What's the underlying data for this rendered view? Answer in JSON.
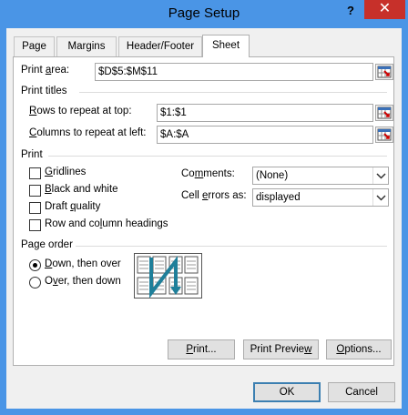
{
  "window": {
    "title": "Page Setup",
    "help_label": "?",
    "close_label": "✕"
  },
  "tabs": [
    {
      "label": "Page"
    },
    {
      "label": "Margins"
    },
    {
      "label": "Header/Footer"
    },
    {
      "label": "Sheet"
    }
  ],
  "print_area": {
    "label_pre": "Print ",
    "label_key": "a",
    "label_post": "rea:",
    "value": "$D$5:$M$11"
  },
  "print_titles": {
    "heading": "Print titles",
    "rows": {
      "label_key": "R",
      "label_post": "ows to repeat at top:",
      "value": "$1:$1"
    },
    "columns": {
      "label_key": "C",
      "label_post": "olumns to repeat at left:",
      "value": "$A:$A"
    }
  },
  "print": {
    "heading": "Print",
    "gridlines": {
      "label_key": "G",
      "label_post": "ridlines",
      "checked": false
    },
    "black_white": {
      "label_key": "B",
      "label_post": "lack and white",
      "checked": false
    },
    "draft": {
      "label_pre": "Draft ",
      "label_key": "q",
      "label_post": "uality",
      "checked": false
    },
    "headings": {
      "label_pre": "Row and co",
      "label_key": "l",
      "label_post": "umn headings",
      "checked": false
    },
    "comments": {
      "label_pre": "Co",
      "label_key": "m",
      "label_post": "ments:",
      "value": "(None)"
    },
    "cell_errors": {
      "label_pre": "Cell ",
      "label_key": "e",
      "label_post": "rrors as:",
      "value": "displayed"
    }
  },
  "page_order": {
    "heading": "Page order",
    "down_over": {
      "label_key": "D",
      "label_post": "own, then over",
      "selected": true
    },
    "over_down": {
      "label_pre": "O",
      "label_key": "v",
      "label_post": "er, then down",
      "selected": false
    }
  },
  "buttons": {
    "print": {
      "label_key": "P",
      "label_post": "rint..."
    },
    "preview": {
      "label_pre": "Print Previe",
      "label_key": "w",
      "label_post": ""
    },
    "options": {
      "label_key": "O",
      "label_post": "ptions..."
    },
    "ok": "OK",
    "cancel": "Cancel"
  },
  "colors": {
    "title_bar": "#4a95e6",
    "close": "#c7302a",
    "order_arrow": "#1f7f9a"
  }
}
